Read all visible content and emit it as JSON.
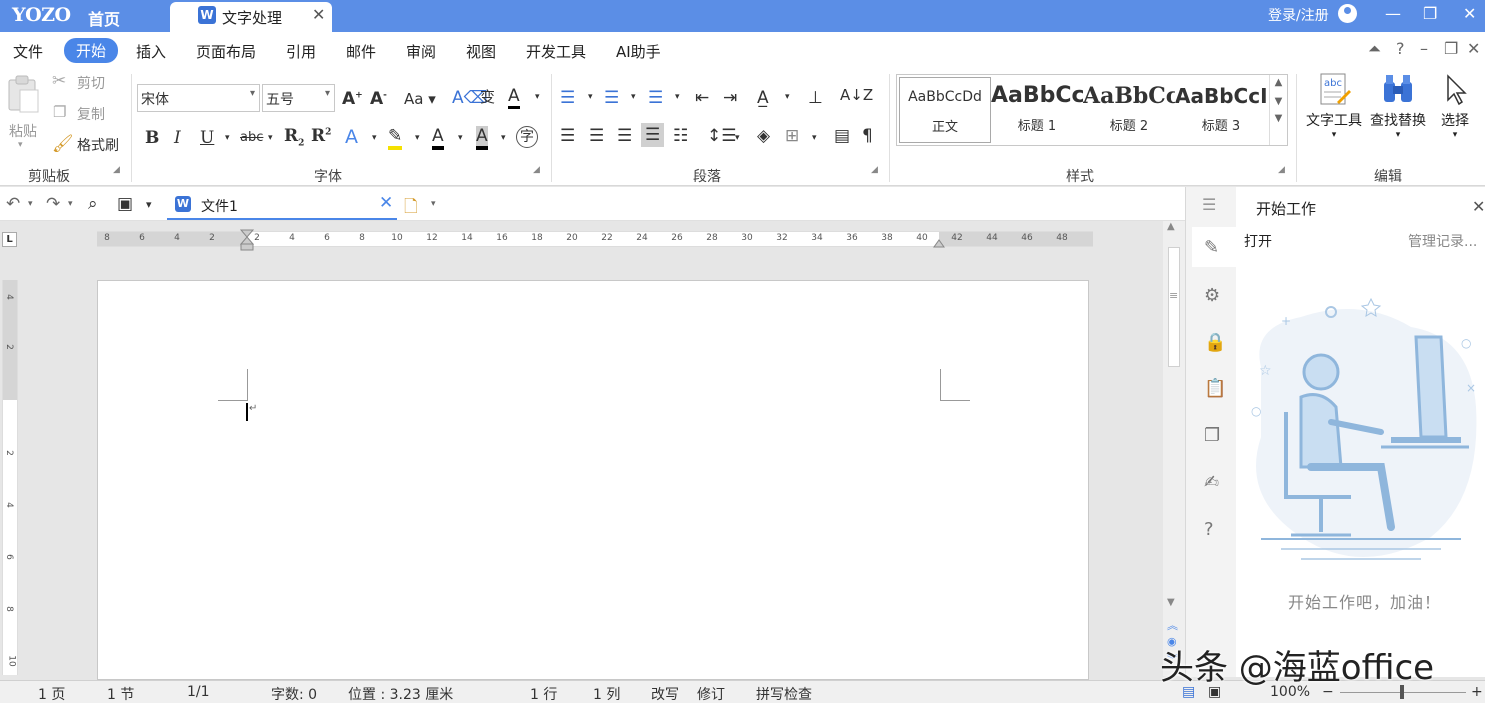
{
  "titlebar": {
    "logo": "YOZO",
    "home_tab": "首页",
    "doc_tab": "文字处理",
    "login": "登录/注册"
  },
  "menu": {
    "items": [
      "文件",
      "开始",
      "插入",
      "页面布局",
      "引用",
      "邮件",
      "审阅",
      "视图",
      "开发工具",
      "AI助手"
    ],
    "active": "开始"
  },
  "ribbon": {
    "clipboard": {
      "paste": "粘贴",
      "cut": "剪切",
      "copy": "复制",
      "format_painter": "格式刷",
      "group": "剪贴板"
    },
    "font": {
      "family": "宋体",
      "size": "五号",
      "group": "字体"
    },
    "paragraph": {
      "group": "段落"
    },
    "styles": {
      "items": [
        {
          "sample": "AaBbCcDd",
          "name": "正文"
        },
        {
          "sample": "AaBbCc",
          "name": "标题 1"
        },
        {
          "sample": "AaBbCc",
          "name": "标题 2"
        },
        {
          "sample": "AaBbCcI",
          "name": "标题 3"
        }
      ],
      "group": "样式"
    },
    "edit": {
      "text_tools": "文字工具",
      "find_replace": "查找替换",
      "select": "选择",
      "group": "编辑"
    }
  },
  "doc": {
    "tab_name": "文件1"
  },
  "ruler": {
    "h_ticks": [
      "8",
      "6",
      "4",
      "2",
      "2",
      "4",
      "6",
      "8",
      "10",
      "12",
      "14",
      "16",
      "18",
      "20",
      "22",
      "24",
      "26",
      "28",
      "30",
      "32",
      "34",
      "36",
      "38",
      "40",
      "42",
      "44",
      "46",
      "48"
    ],
    "v_ticks": [
      "4",
      "2",
      "2",
      "4",
      "6",
      "8",
      "10"
    ]
  },
  "panel": {
    "title": "开始工作",
    "open": "打开",
    "manage": "管理记录...",
    "message": "开始工作吧，加油！"
  },
  "status": {
    "page": "1 页",
    "section": "1 节",
    "pages": "1/1",
    "words": "字数: 0",
    "position": "位置 : 3.23 厘米",
    "line": "1 行",
    "column": "1 列",
    "overwrite": "改写",
    "revise": "修订",
    "spellcheck": "拼写检查",
    "zoom": "100%"
  },
  "watermark": "头条 @海蓝office",
  "colors": {
    "accent": "#4a86e8",
    "titlebar": "#5b8ee6",
    "illustration": "#8fb6dc"
  }
}
